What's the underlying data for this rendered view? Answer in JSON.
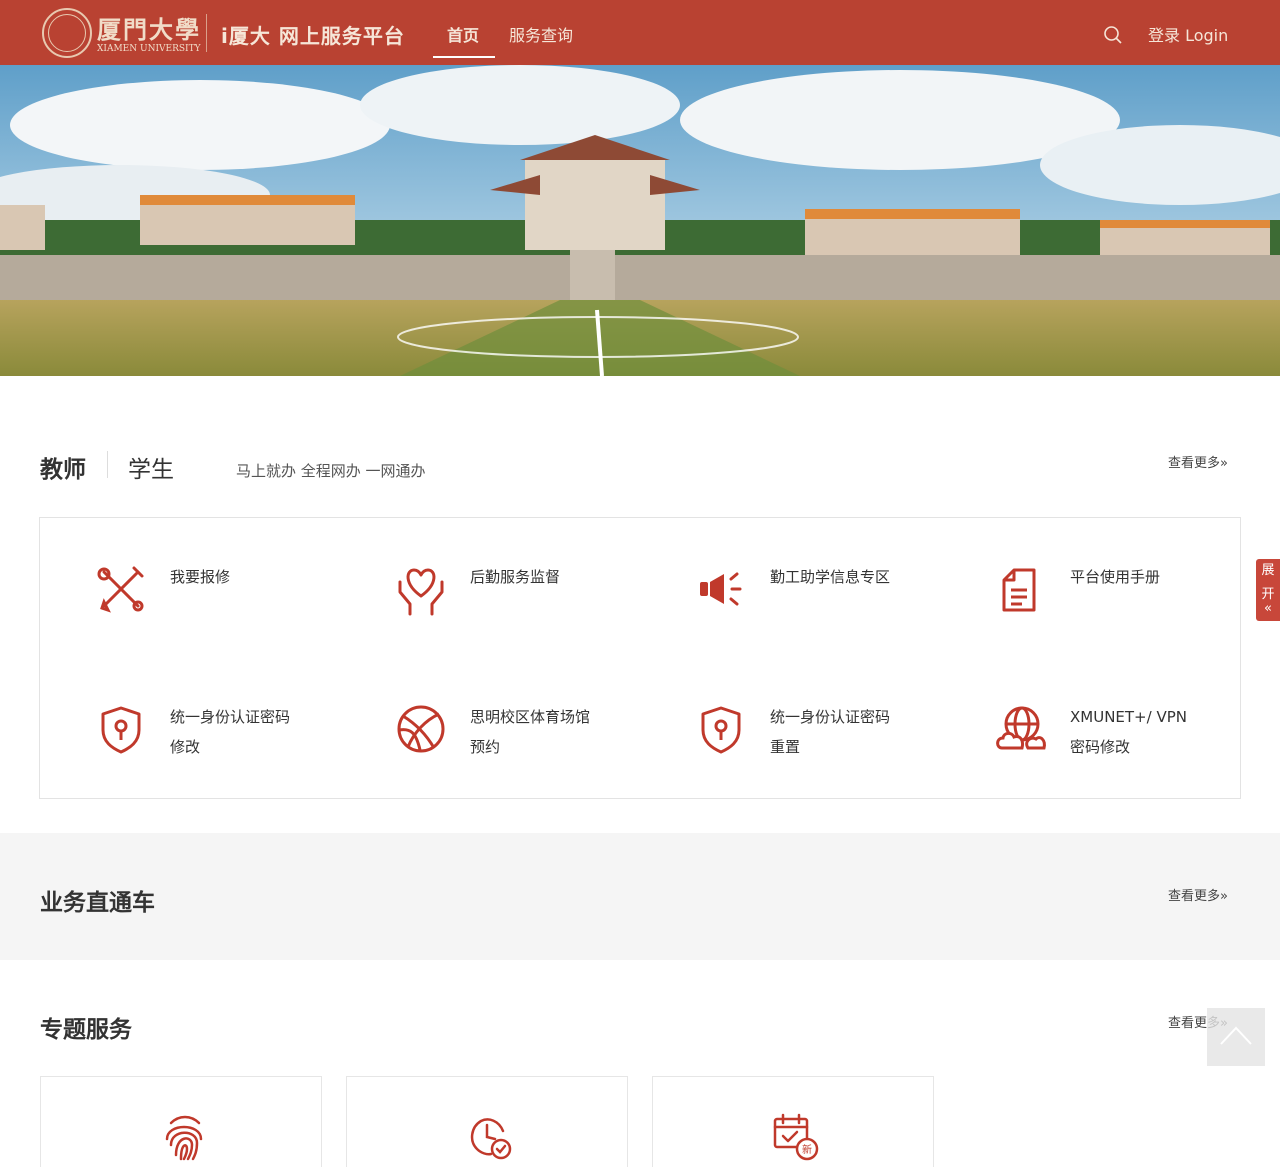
{
  "header": {
    "logo_cn": "厦門大學",
    "logo_en": "XIAMEN UNIVERSITY",
    "platform_title": "i厦大 网上服务平台",
    "nav": {
      "home": "首页",
      "query": "服务查询"
    },
    "login": "登录 Login"
  },
  "section_services": {
    "tab_teacher": "教师",
    "tab_student": "学生",
    "slogan": "马上就办 全程网办 一网通办",
    "more": "查看更多»",
    "items": [
      {
        "label": "我要报修",
        "icon": "repair-tools-icon"
      },
      {
        "label": "后勤服务监督",
        "icon": "heart-hands-icon"
      },
      {
        "label": "勤工助学信息专区",
        "icon": "megaphone-icon"
      },
      {
        "label": "平台使用手册",
        "icon": "document-icon"
      },
      {
        "label": "统一身份认证密码修改",
        "icon": "shield-lock-icon"
      },
      {
        "label": "思明校区体育场馆预约",
        "icon": "basketball-icon"
      },
      {
        "label": "统一身份认证密码重置",
        "icon": "shield-lock-icon"
      },
      {
        "label": "XMUNET+/ VPN密码修改",
        "icon": "globe-cloud-icon"
      }
    ]
  },
  "section_express": {
    "title": "业务直通车",
    "more": "查看更多»"
  },
  "section_topics": {
    "title": "专题服务",
    "more": "查看更多»",
    "cards": [
      {
        "icon": "fingerprint-icon"
      },
      {
        "icon": "clock-check-icon"
      },
      {
        "icon": "calendar-new-icon",
        "badge": "新"
      }
    ]
  },
  "side_tab": {
    "label1": "展",
    "label2": "开",
    "arrow": "«"
  },
  "colors": {
    "brand": "#b94232",
    "icon_red": "#c0392b"
  }
}
